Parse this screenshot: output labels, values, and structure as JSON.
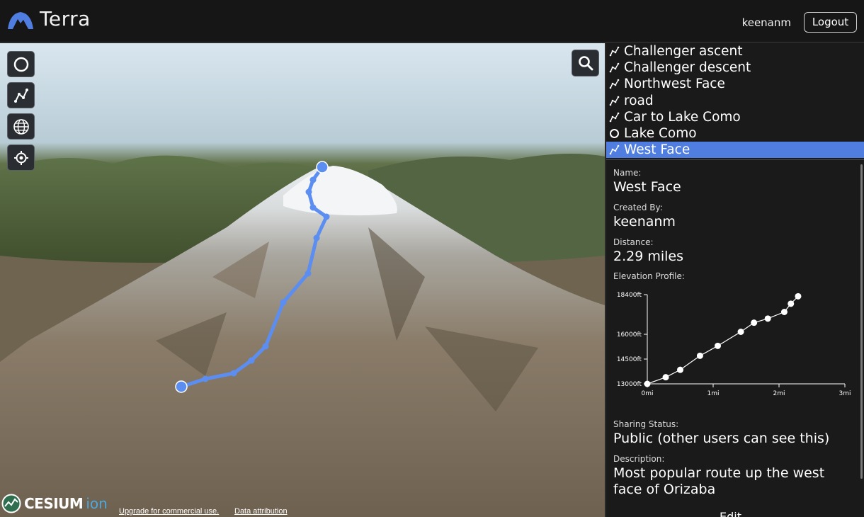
{
  "header": {
    "app_title": "Terra",
    "username": "keenanm",
    "logout_label": "Logout"
  },
  "map": {
    "tools": [
      {
        "name": "circle-tool",
        "icon": "circle-icon"
      },
      {
        "name": "route-tool",
        "icon": "route-icon"
      },
      {
        "name": "globe-tool",
        "icon": "globe-icon"
      },
      {
        "name": "locate-tool",
        "icon": "crosshair-icon"
      }
    ],
    "search_icon": "search-icon",
    "cesium_brand": "CESIUM",
    "cesium_ion": "ion",
    "upgrade_link": "Upgrade for commercial use.",
    "attribution_link": "Data attribution",
    "route_color": "#5b8ef0"
  },
  "sidebar": {
    "items": [
      {
        "label": "Challenger ascent",
        "type": "route",
        "selected": false
      },
      {
        "label": "Challenger descent",
        "type": "route",
        "selected": false
      },
      {
        "label": "Northwest Face",
        "type": "route",
        "selected": false
      },
      {
        "label": "road",
        "type": "route",
        "selected": false
      },
      {
        "label": "Car to Lake Como",
        "type": "route",
        "selected": false
      },
      {
        "label": "Lake Como",
        "type": "point",
        "selected": false
      },
      {
        "label": "West Face",
        "type": "route",
        "selected": true
      }
    ],
    "selected_color": "#4f7de0"
  },
  "details": {
    "name_label": "Name:",
    "name_value": "West Face",
    "created_by_label": "Created By:",
    "created_by_value": "keenanm",
    "distance_label": "Distance:",
    "distance_value": "2.29 miles",
    "elevation_label": "Elevation Profile:",
    "sharing_label": "Sharing Status:",
    "sharing_value": "Public (other users can see this)",
    "description_label": "Description:",
    "description_value": "Most popular route up the west face of Orizaba",
    "edit_label": "Edit"
  },
  "chart_data": {
    "type": "line",
    "title": "",
    "xlabel": "",
    "ylabel": "",
    "x_ticks": [
      0,
      1,
      2,
      3
    ],
    "x_tick_labels": [
      "0mi",
      "1mi",
      "2mi",
      "3mi"
    ],
    "y_ticks": [
      13000,
      14500,
      16000,
      18400
    ],
    "y_tick_labels": [
      "13000ft",
      "14500ft",
      "16000ft",
      "18400ft"
    ],
    "xlim": [
      0,
      3
    ],
    "ylim": [
      13000,
      18400
    ],
    "grid": false,
    "series": [
      {
        "x": [
          0.0,
          0.28,
          0.5,
          0.8,
          1.07,
          1.42,
          1.62,
          1.83,
          2.08,
          2.18,
          2.29
        ],
        "y": [
          13000,
          13400,
          13850,
          14700,
          15300,
          16150,
          16700,
          16950,
          17350,
          17850,
          18300
        ]
      }
    ]
  }
}
